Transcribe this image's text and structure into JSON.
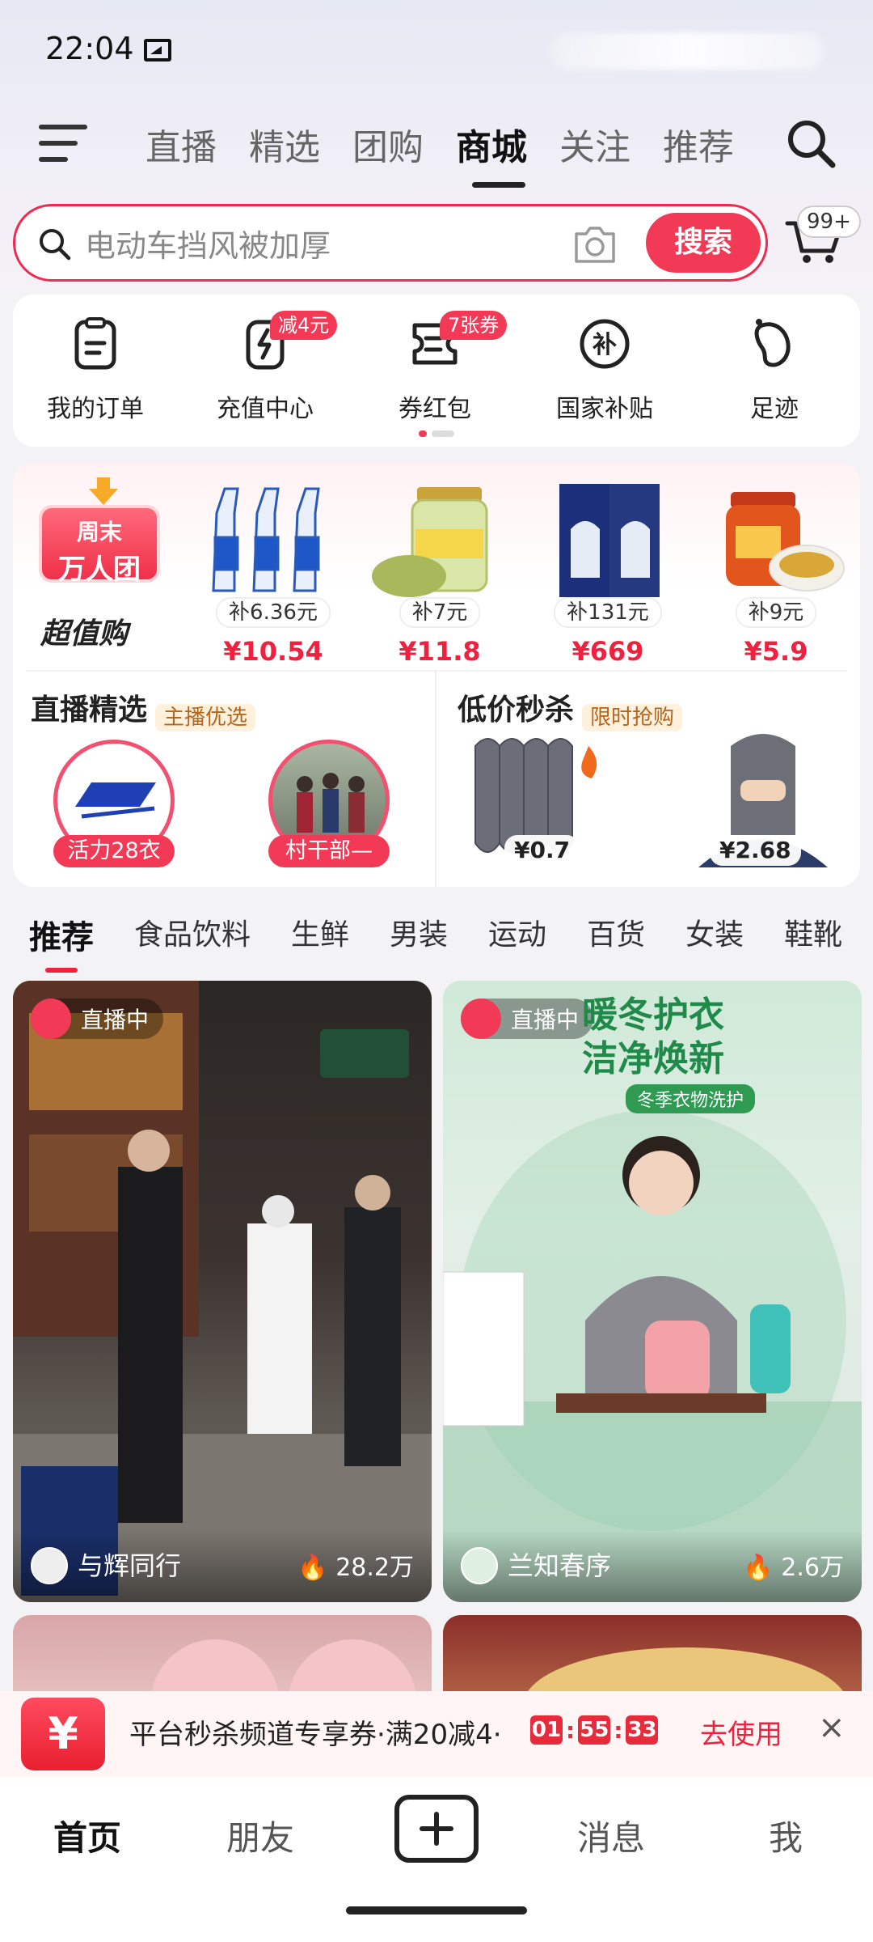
{
  "status_bar": {
    "time": "22:04"
  },
  "top_nav": {
    "tabs": [
      {
        "label": "直播",
        "active": false
      },
      {
        "label": "精选",
        "active": false
      },
      {
        "label": "团购",
        "active": false
      },
      {
        "label": "商城",
        "active": true
      },
      {
        "label": "关注",
        "active": false
      },
      {
        "label": "推荐",
        "active": false
      }
    ]
  },
  "search": {
    "placeholder": "电动车挡风被加厚",
    "button_label": "搜索",
    "cart_badge": "99+"
  },
  "quick_menu": [
    {
      "label": "我的订单",
      "icon": "order-icon",
      "badge": ""
    },
    {
      "label": "充值中心",
      "icon": "recharge-icon",
      "badge": "减4元"
    },
    {
      "label": "券红包",
      "icon": "coupon-icon",
      "badge": "7张券"
    },
    {
      "label": "国家补贴",
      "icon": "subsidy-icon",
      "badge": ""
    },
    {
      "label": "足迹",
      "icon": "footprint-icon",
      "badge": ""
    }
  ],
  "deals": {
    "badge_line1": "周末",
    "badge_line2": "万人团",
    "title": "超值购",
    "products": [
      {
        "subsidy": "补6.36元",
        "price": "¥10.54"
      },
      {
        "subsidy": "补7元",
        "price": "¥11.8"
      },
      {
        "subsidy": "补131元",
        "price": "¥669"
      },
      {
        "subsidy": "补9元",
        "price": "¥5.9"
      }
    ],
    "live_section": {
      "title": "直播精选",
      "tag": "主播优选",
      "items": [
        {
          "caption": "活力28衣"
        },
        {
          "caption": "村干部—"
        }
      ]
    },
    "flash_section": {
      "title": "低价秒杀",
      "tag": "限时抢购",
      "items": [
        {
          "price": "¥0.7"
        },
        {
          "price": "¥2.68"
        }
      ]
    }
  },
  "categories": [
    {
      "label": "推荐",
      "active": true
    },
    {
      "label": "食品饮料",
      "active": false
    },
    {
      "label": "生鲜",
      "active": false
    },
    {
      "label": "男装",
      "active": false
    },
    {
      "label": "运动",
      "active": false
    },
    {
      "label": "百货",
      "active": false
    },
    {
      "label": "女装",
      "active": false
    },
    {
      "label": "鞋靴",
      "active": false
    }
  ],
  "feed": [
    {
      "live_label": "直播中",
      "name": "与辉同行",
      "count": "28.2万"
    },
    {
      "live_label": "直播中",
      "name": "兰知春序",
      "count": "2.6万",
      "overlay_line1": "暖冬护衣",
      "overlay_line2": "洁净焕新",
      "overlay_sub": "冬季衣物洗护"
    }
  ],
  "promo": {
    "icon_symbol": "¥",
    "text": "平台秒杀频道专享券·满20减4·",
    "timer": [
      "01",
      "55",
      "33"
    ],
    "action": "去使用",
    "close": "×"
  },
  "bottom_nav": [
    {
      "label": "首页",
      "active": true
    },
    {
      "label": "朋友",
      "active": false
    },
    {
      "label": "消息",
      "active": false
    },
    {
      "label": "我",
      "active": false
    }
  ],
  "colors": {
    "accent": "#f23a57",
    "price": "#f0213f"
  }
}
